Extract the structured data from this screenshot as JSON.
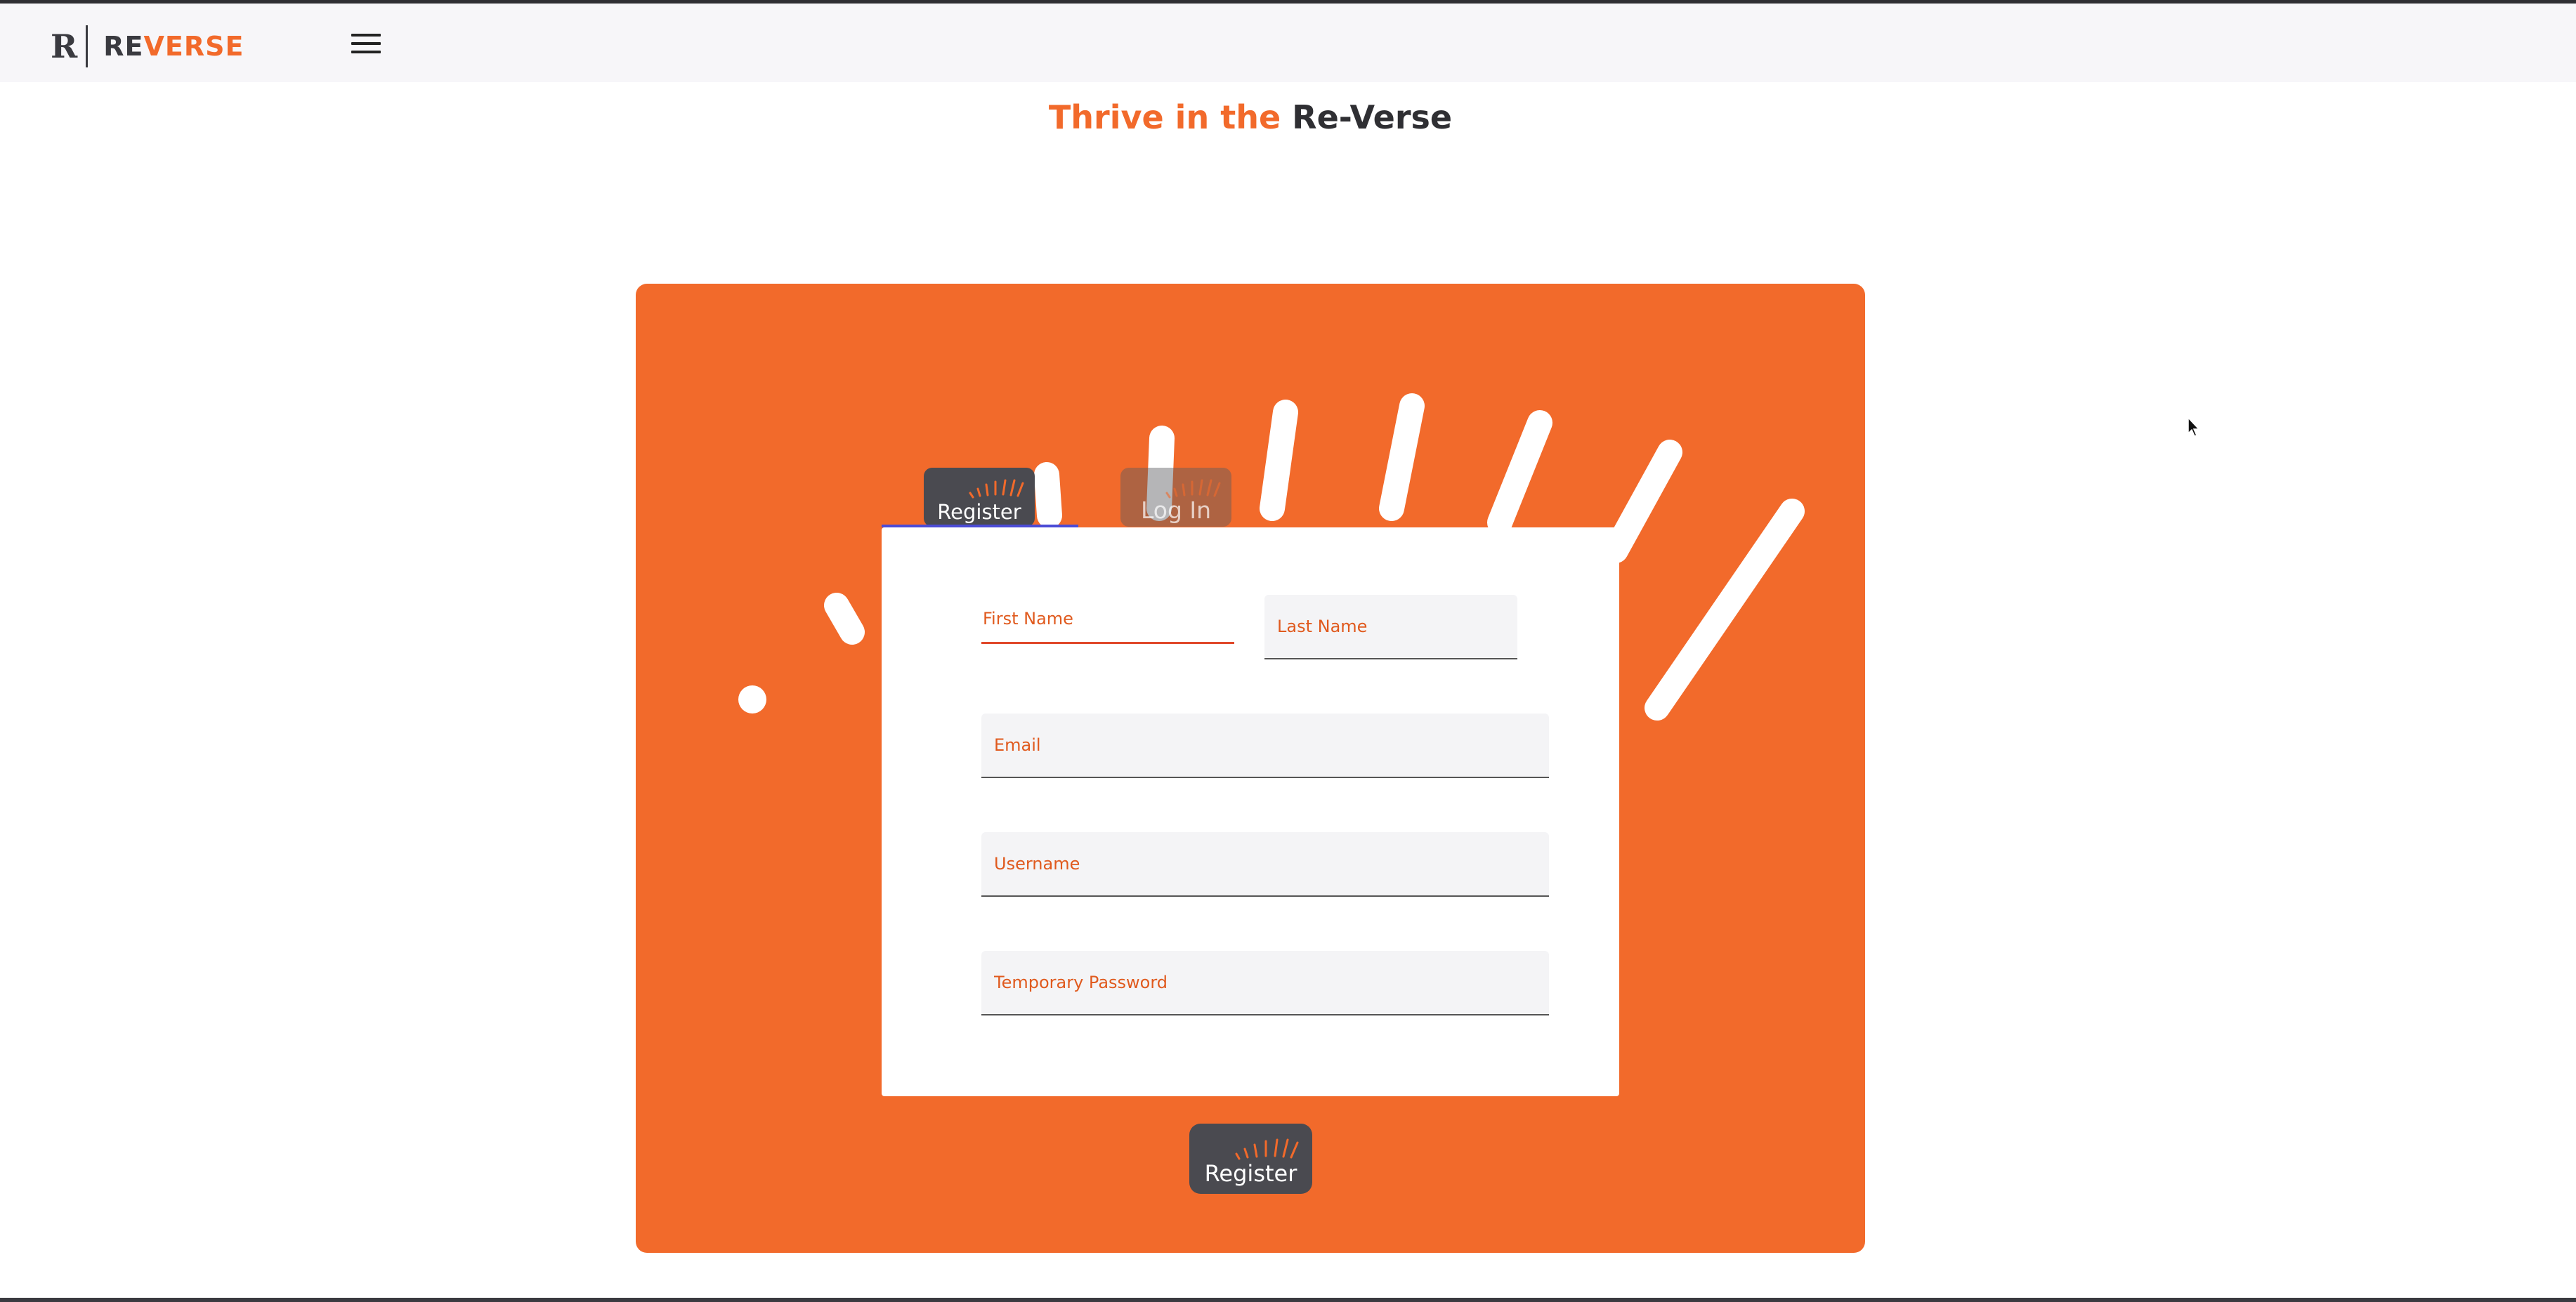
{
  "brand": {
    "logo_letter": "R",
    "name_part1": "RE",
    "name_part2": "VERSE",
    "color_orange": "#f26a2b",
    "color_dark": "#3a3a40"
  },
  "header": {
    "menu_icon": "hamburger-menu-icon"
  },
  "hero": {
    "title_part1": "Thrive in the",
    "title_part2": "Re-Verse"
  },
  "tabs": [
    {
      "label": "Register",
      "active": true
    },
    {
      "label": "Log In",
      "active": false
    }
  ],
  "form": {
    "first_name_placeholder": "First Name",
    "last_name_placeholder": "Last Name",
    "email_placeholder": "Email",
    "username_placeholder": "Username",
    "password_placeholder": "Temporary Password",
    "submit_label": "Register"
  },
  "colors": {
    "panel_background": "#f26a2b",
    "button_background": "#4a4a50",
    "tab_underline": "#4b4bd6"
  }
}
